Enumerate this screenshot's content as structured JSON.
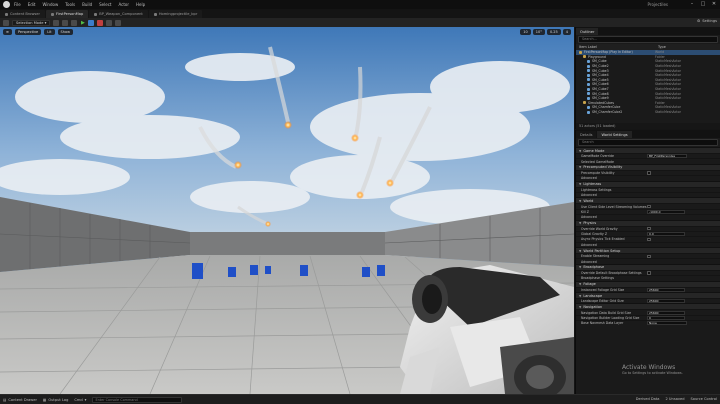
{
  "title_bar": {
    "menu": [
      "File",
      "Edit",
      "Window",
      "Tools",
      "Build",
      "Select",
      "Actor",
      "Help"
    ],
    "project": "Projectiles"
  },
  "tabs": [
    {
      "label": "Content Browser",
      "active": false
    },
    {
      "label": "FirstPersonMap",
      "active": true
    },
    {
      "label": "BP_Weapon_Component",
      "active": false
    },
    {
      "label": "Homingprojectile_bpr",
      "active": false
    }
  ],
  "toolbar": {
    "mode": "Selection Mode",
    "settings": "Settings"
  },
  "viewport": {
    "toolbar_left": [
      "Perspective",
      "Lit",
      "Show"
    ],
    "toolbar_right": [
      "10",
      "10°",
      "0.25",
      "4"
    ]
  },
  "outliner": {
    "tab": "Outliner",
    "search_placeholder": "Search...",
    "col_label": "Item Label",
    "col_type": "Type",
    "rows": [
      {
        "label": "FirstPersonMap (Play In Editor)",
        "type": "World",
        "icon": "folder"
      },
      {
        "label": "Playground",
        "type": "Folder",
        "icon": "folder"
      },
      {
        "label": "SM_Cube",
        "type": "StaticMeshActor",
        "icon": "mesh"
      },
      {
        "label": "SM_Cube2",
        "type": "StaticMeshActor",
        "icon": "mesh"
      },
      {
        "label": "SM_Cube3",
        "type": "StaticMeshActor",
        "icon": "mesh"
      },
      {
        "label": "SM_Cube4",
        "type": "StaticMeshActor",
        "icon": "mesh"
      },
      {
        "label": "SM_Cube5",
        "type": "StaticMeshActor",
        "icon": "mesh"
      },
      {
        "label": "SM_Cube6",
        "type": "StaticMeshActor",
        "icon": "mesh"
      },
      {
        "label": "SM_Cube7",
        "type": "StaticMeshActor",
        "icon": "mesh"
      },
      {
        "label": "SM_Cube8",
        "type": "StaticMeshActor",
        "icon": "mesh"
      },
      {
        "label": "SM_Cube9",
        "type": "StaticMeshActor",
        "icon": "mesh"
      },
      {
        "label": "SimulatedCubes",
        "type": "Folder",
        "icon": "folder"
      },
      {
        "label": "SM_ChamferCube",
        "type": "StaticMeshActor",
        "icon": "mesh"
      },
      {
        "label": "SM_ChamferCube2",
        "type": "StaticMeshActor",
        "icon": "mesh"
      }
    ],
    "count": "51 actors (51 loaded)"
  },
  "details": {
    "tabs": [
      "Details",
      "World Settings"
    ],
    "search_placeholder": "Search",
    "sections": [
      {
        "title": "Game Mode",
        "rows": [
          {
            "name": "GameMode Override",
            "kind": "dropdown",
            "value": "BP_FirstPersonGa"
          },
          {
            "name": "Selected GameMode",
            "kind": "none",
            "value": ""
          }
        ]
      },
      {
        "title": "Precomputed Visibility",
        "rows": [
          {
            "name": "Precompute Visibility",
            "kind": "check",
            "value": "off"
          },
          {
            "name": "Advanced",
            "kind": "none",
            "value": ""
          }
        ]
      },
      {
        "title": "Lightmass",
        "rows": [
          {
            "name": "Lightmass Settings",
            "kind": "none",
            "value": ""
          },
          {
            "name": "Advanced",
            "kind": "none",
            "value": ""
          }
        ]
      },
      {
        "title": "World",
        "rows": [
          {
            "name": "Use Client Side Level Streaming Volumes",
            "kind": "check",
            "value": "off"
          },
          {
            "name": "Kill Z",
            "kind": "number",
            "value": "-1000.0"
          },
          {
            "name": "Advanced",
            "kind": "none",
            "value": ""
          }
        ]
      },
      {
        "title": "Physics",
        "rows": [
          {
            "name": "Override World Gravity",
            "kind": "check",
            "value": "off"
          },
          {
            "name": "Global Gravity Z",
            "kind": "number",
            "value": "0.0"
          },
          {
            "name": "Async Physics Tick Enabled",
            "kind": "check",
            "value": "off"
          },
          {
            "name": "Advanced",
            "kind": "none",
            "value": ""
          }
        ]
      },
      {
        "title": "World Partition Setup",
        "rows": [
          {
            "name": "Enable Streaming",
            "kind": "check",
            "value": "off"
          },
          {
            "name": "Advanced",
            "kind": "none",
            "value": ""
          }
        ]
      },
      {
        "title": "Broadphase",
        "rows": [
          {
            "name": "Override Default Broadphase Settings",
            "kind": "check",
            "value": "off"
          },
          {
            "name": "Broadphase Settings",
            "kind": "none",
            "value": ""
          }
        ]
      },
      {
        "title": "Foliage",
        "rows": [
          {
            "name": "Instanced Foliage Grid Size",
            "kind": "number",
            "value": "25600"
          }
        ]
      },
      {
        "title": "Landscape",
        "rows": [
          {
            "name": "Landscape Editor Grid Size",
            "kind": "number",
            "value": "25600"
          }
        ]
      },
      {
        "title": "Navigation",
        "rows": [
          {
            "name": "Navigation Data Build Grid Size",
            "kind": "number",
            "value": "25600"
          },
          {
            "name": "Navigation Builder Loading Grid Size",
            "kind": "number",
            "value": "0"
          },
          {
            "name": "Base Navmesh Data Layer",
            "kind": "dropdown",
            "value": "None"
          }
        ]
      }
    ]
  },
  "statusbar": {
    "items": [
      "Content Drawer",
      "Output Log",
      "Cmd"
    ],
    "cmd_placeholder": "Enter Console Command",
    "right": [
      "Derived Data",
      "2 Unsaved",
      "Source Control"
    ]
  },
  "watermark": {
    "line1": "Activate Windows",
    "line2": "Go to Settings to activate Windows."
  }
}
